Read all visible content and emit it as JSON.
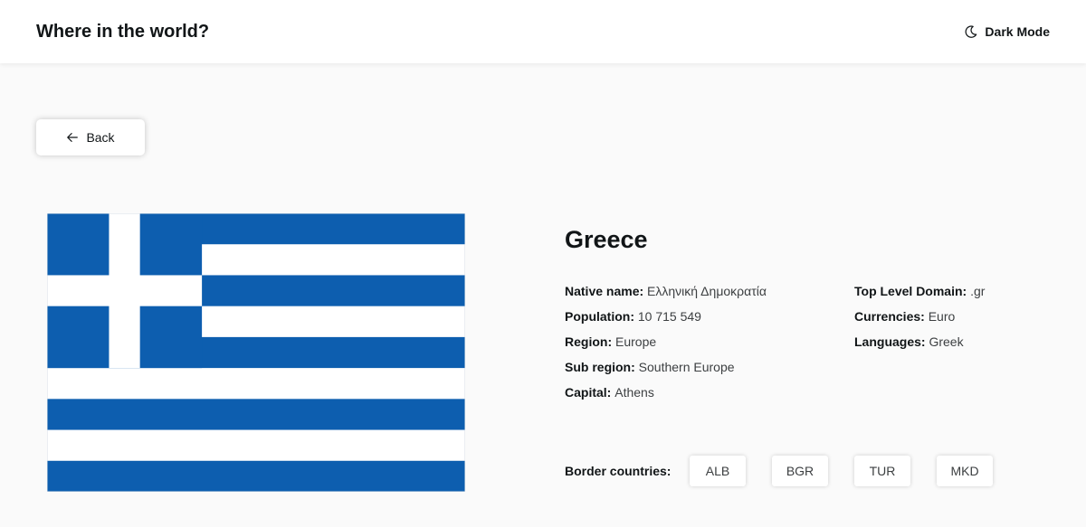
{
  "header": {
    "title": "Where in the world?",
    "dark_mode_label": "Dark Mode",
    "dark_mode_icon": "moon-icon"
  },
  "back": {
    "label": "Back",
    "icon": "arrow-left-icon"
  },
  "flag": {
    "icon": "greece-flag",
    "colors": {
      "blue": "#0d5eaf",
      "white": "#ffffff"
    }
  },
  "country": {
    "name": "Greece",
    "details_left": [
      {
        "label": "Native name:",
        "value": "Ελληνική Δημοκρατία"
      },
      {
        "label": "Population:",
        "value": "10 715 549"
      },
      {
        "label": "Region:",
        "value": "Europe"
      },
      {
        "label": "Sub region:",
        "value": "Southern Europe"
      },
      {
        "label": "Capital:",
        "value": "Athens"
      }
    ],
    "details_right": [
      {
        "label": "Top Level Domain:",
        "value": ".gr"
      },
      {
        "label": "Currencies:",
        "value": "Euro"
      },
      {
        "label": "Languages:",
        "value": "Greek"
      }
    ],
    "border_label": "Border countries:",
    "borders": [
      "ALB",
      "BGR",
      "TUR",
      "MKD"
    ]
  }
}
